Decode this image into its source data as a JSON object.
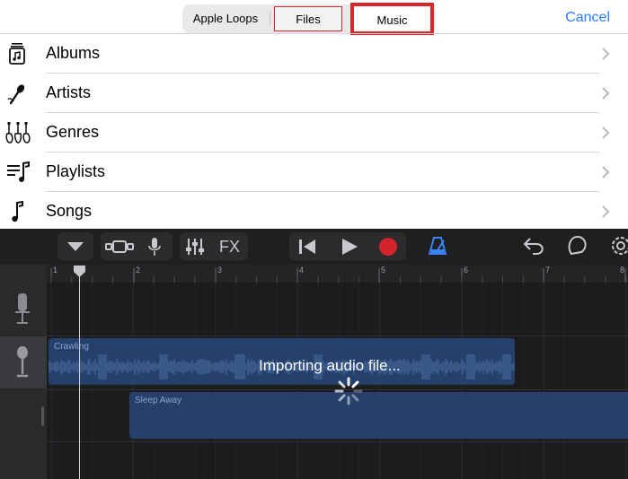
{
  "tabs": {
    "apple_loops": "Apple Loops",
    "files": "Files",
    "music": "Music",
    "cancel": "Cancel"
  },
  "list": [
    {
      "label": "Albums",
      "icon": "album-icon"
    },
    {
      "label": "Artists",
      "icon": "microphone-icon"
    },
    {
      "label": "Genres",
      "icon": "guitars-icon"
    },
    {
      "label": "Playlists",
      "icon": "playlist-icon"
    },
    {
      "label": "Songs",
      "icon": "music-note-icon"
    }
  ],
  "toolbar": {
    "fx_label": "FX"
  },
  "ruler": {
    "bars": [
      "1",
      "2",
      "3",
      "4",
      "5",
      "6",
      "7",
      "8"
    ]
  },
  "regions": {
    "region1_name": "Crawling",
    "region2_name": "Sleep Away"
  },
  "status": {
    "importing": "Importing audio file..."
  },
  "colors": {
    "accent_blue": "#2f7cf6",
    "highlight_red": "#d9262b",
    "record_red": "#d1242c",
    "region_blue": "#24406b",
    "metronome_blue": "#3b82f6"
  }
}
